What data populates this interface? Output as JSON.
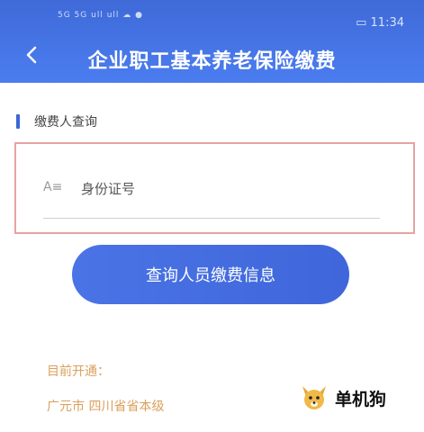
{
  "status_bar": {
    "left_text": "5G 5G ull ull ☁ ●",
    "right_text": "▭ 11:34"
  },
  "header": {
    "title": "企业职工基本养老保险缴费",
    "back_icon": "chevron-left-icon"
  },
  "section": {
    "label": "缴费人查询"
  },
  "form": {
    "field_label": "A≡",
    "id_input_placeholder": "身份证号",
    "id_input_value": ""
  },
  "query_button": {
    "label": "查询人员缴费信息"
  },
  "notice": {
    "title": "目前开通：",
    "cities": "广元市 四川省省本级"
  },
  "watermark": {
    "text": "单机狗"
  },
  "colors": {
    "primary": "#4a74e6",
    "header": "#3f6ad8",
    "notice": "#d9a05b",
    "input_border": "#e8a2a2"
  }
}
